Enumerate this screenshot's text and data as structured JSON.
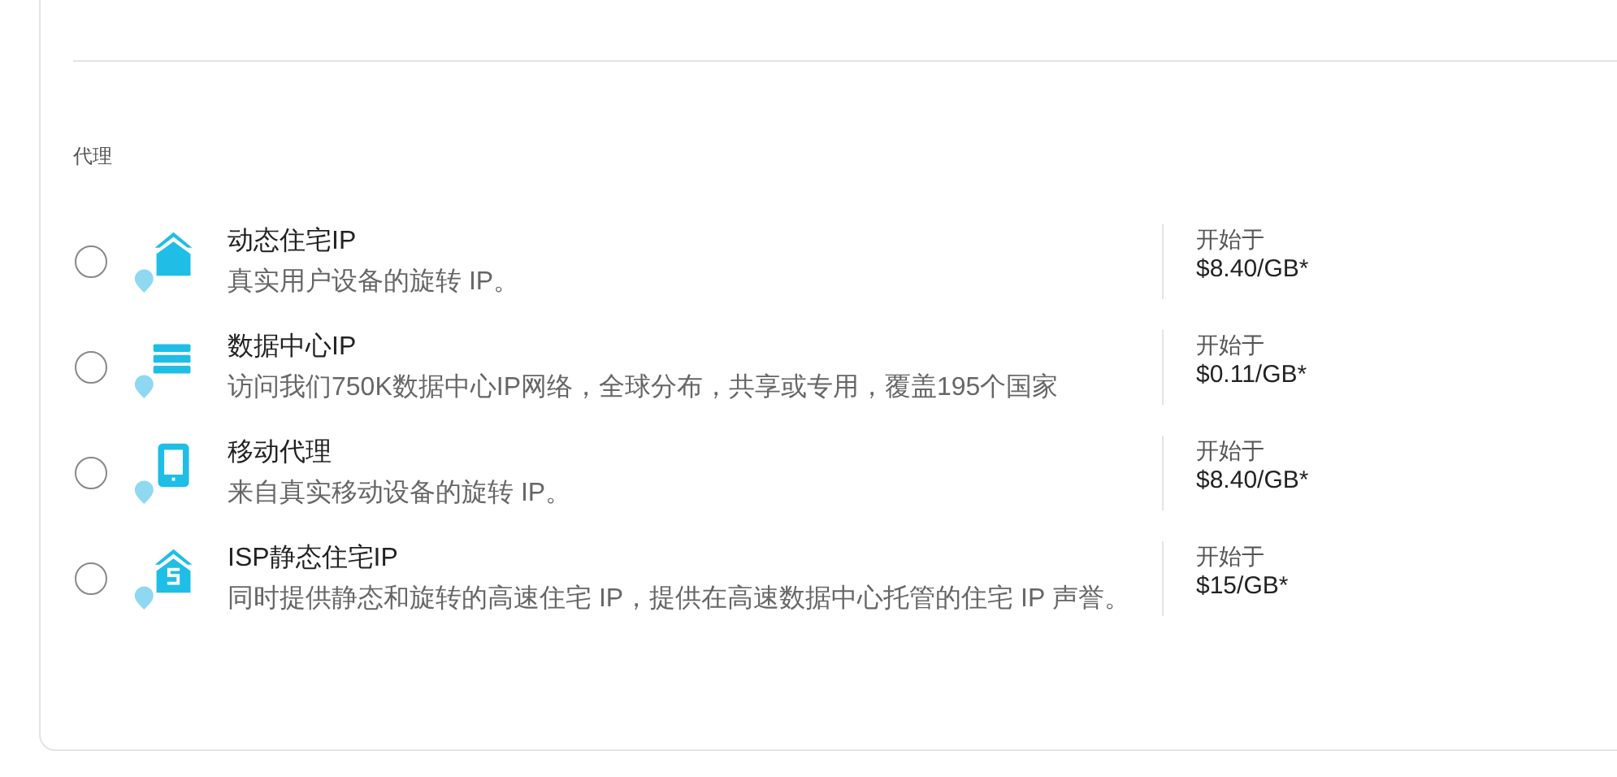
{
  "section": {
    "label": "代理"
  },
  "options": [
    {
      "kind": "house",
      "title": "动态住宅IP",
      "description": "真实用户设备的旋转 IP。",
      "price_label": "开始于",
      "price": "$8.40/GB*",
      "selected": false
    },
    {
      "kind": "server",
      "title": "数据中心IP",
      "description": "访问我们750K数据中心IP网络，全球分布，共享或专用，覆盖195个国家",
      "price_label": "开始于",
      "price": "$0.11/GB*",
      "selected": false
    },
    {
      "kind": "phone",
      "title": "移动代理",
      "description": "来自真实移动设备的旋转 IP。",
      "price_label": "开始于",
      "price": "$8.40/GB*",
      "selected": false
    },
    {
      "kind": "isp",
      "title": "ISP静态住宅IP",
      "description": "同时提供静态和旋转的高速住宅 IP，提供在高速数据中心托管的住宅 IP 声誉。",
      "price_label": "开始于",
      "price": "$15/GB*",
      "selected": false
    }
  ]
}
